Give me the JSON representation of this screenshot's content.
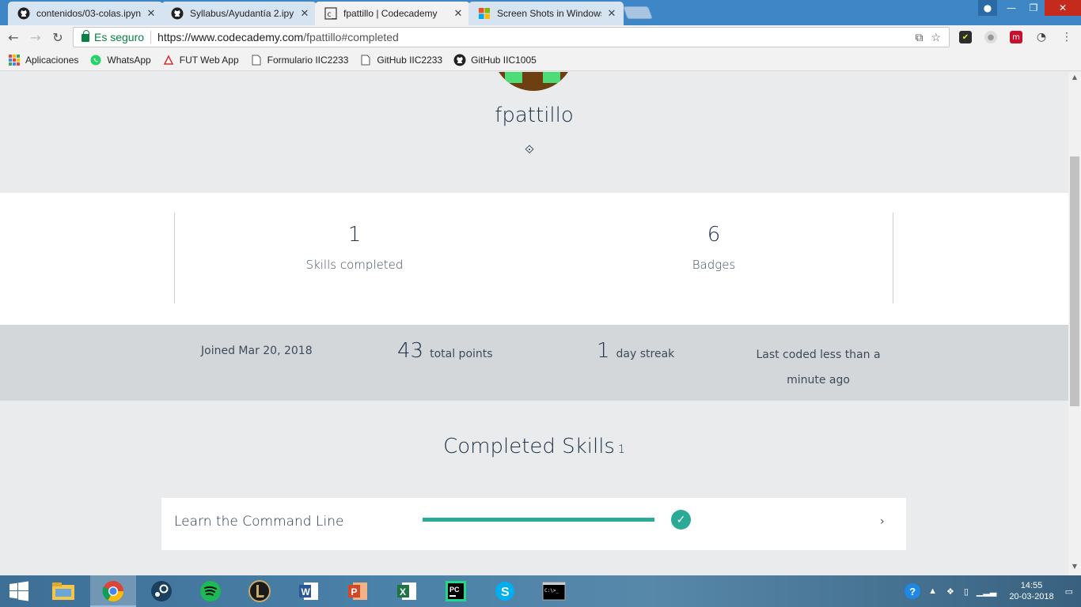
{
  "tabs": [
    {
      "title": "contenidos/03-colas.ipynb",
      "icon": "github-icon",
      "active": false
    },
    {
      "title": "Syllabus/Ayudantía 2.ipynb",
      "icon": "github-icon",
      "active": false
    },
    {
      "title": "fpattillo | Codecademy",
      "icon": "codecademy-icon",
      "active": true
    },
    {
      "title": "Screen Shots in Windows",
      "icon": "windows-icon",
      "active": false
    }
  ],
  "address": {
    "secure_label": "Es seguro",
    "url_host": "https://www.codecademy.com",
    "url_path": "/fpattillo#completed"
  },
  "bookmarks": [
    {
      "label": "Aplicaciones",
      "icon": "apps-grid-icon"
    },
    {
      "label": "WhatsApp",
      "icon": "whatsapp-icon"
    },
    {
      "label": "FUT Web App",
      "icon": "fut-icon"
    },
    {
      "label": "Formulario IIC2233",
      "icon": "page-icon"
    },
    {
      "label": "GitHub IIC2233",
      "icon": "page-icon"
    },
    {
      "label": "GitHub IIC1005",
      "icon": "github-icon"
    }
  ],
  "profile": {
    "username": "fpattillo"
  },
  "stats": {
    "skills_completed_value": "1",
    "skills_completed_label": "Skills completed",
    "badges_value": "6",
    "badges_label": "Badges"
  },
  "activity": {
    "joined": "Joined Mar 20, 2018",
    "points_value": "43",
    "points_label": "total points",
    "streak_value": "1",
    "streak_label": "day streak",
    "last_coded": "Last coded less than a minute ago"
  },
  "completed": {
    "title": "Completed Skills",
    "count": "1",
    "skills": [
      {
        "name": "Learn the Command Line",
        "progress": 1.0
      }
    ]
  },
  "taskbar": {
    "time": "14:55",
    "date": "20-03-2018"
  },
  "colors": {
    "accent": "#2aaa97",
    "text_dark": "#20324a",
    "tabbar": "#3f86c6"
  }
}
